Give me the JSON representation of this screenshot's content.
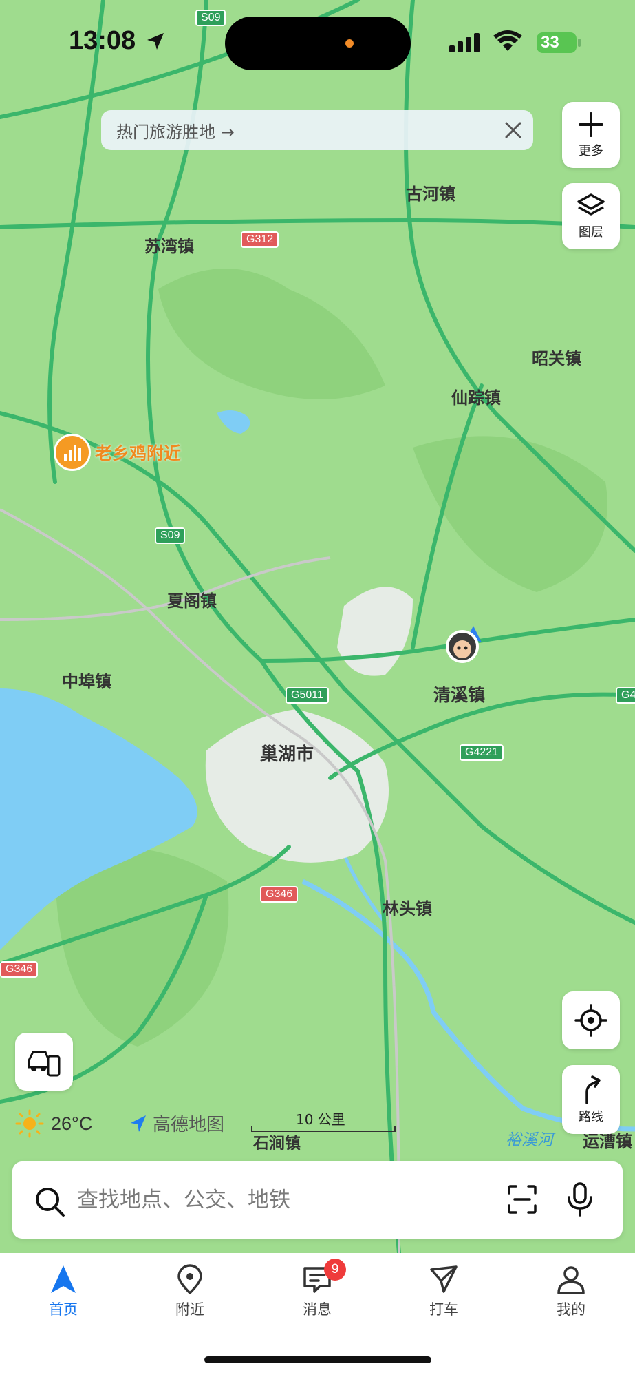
{
  "status": {
    "time": "13:08",
    "battery": "33"
  },
  "banner": {
    "text": "热门旅游胜地 →"
  },
  "buttons": {
    "more": "更多",
    "layers": "图层",
    "route": "路线"
  },
  "map": {
    "places": [
      "古河镇",
      "苏湾镇",
      "昭关镇",
      "仙踪镇",
      "夏阁镇",
      "中埠镇",
      "清溪镇",
      "巢湖市",
      "林头镇",
      "运漕镇",
      "石涧镇"
    ],
    "roads": [
      "S09",
      "G312",
      "S09",
      "G5011",
      "G4221",
      "G346",
      "G346",
      "G4"
    ],
    "poi": "老乡鸡附近",
    "river": "裕溪河"
  },
  "weather": {
    "temp": "26°C"
  },
  "brand": {
    "name": "高德地图"
  },
  "scale": {
    "label": "10 公里"
  },
  "search": {
    "placeholder": "查找地点、公交、地铁"
  },
  "tabs": [
    {
      "label": "首页"
    },
    {
      "label": "附近"
    },
    {
      "label": "消息",
      "badge": "9"
    },
    {
      "label": "打车"
    },
    {
      "label": "我的"
    }
  ],
  "colors": {
    "accent": "#1676ee",
    "map_bg": "#9fdc8e",
    "road": "#3bb66b",
    "water": "#7fcdf5",
    "urban": "#e6ece6"
  }
}
